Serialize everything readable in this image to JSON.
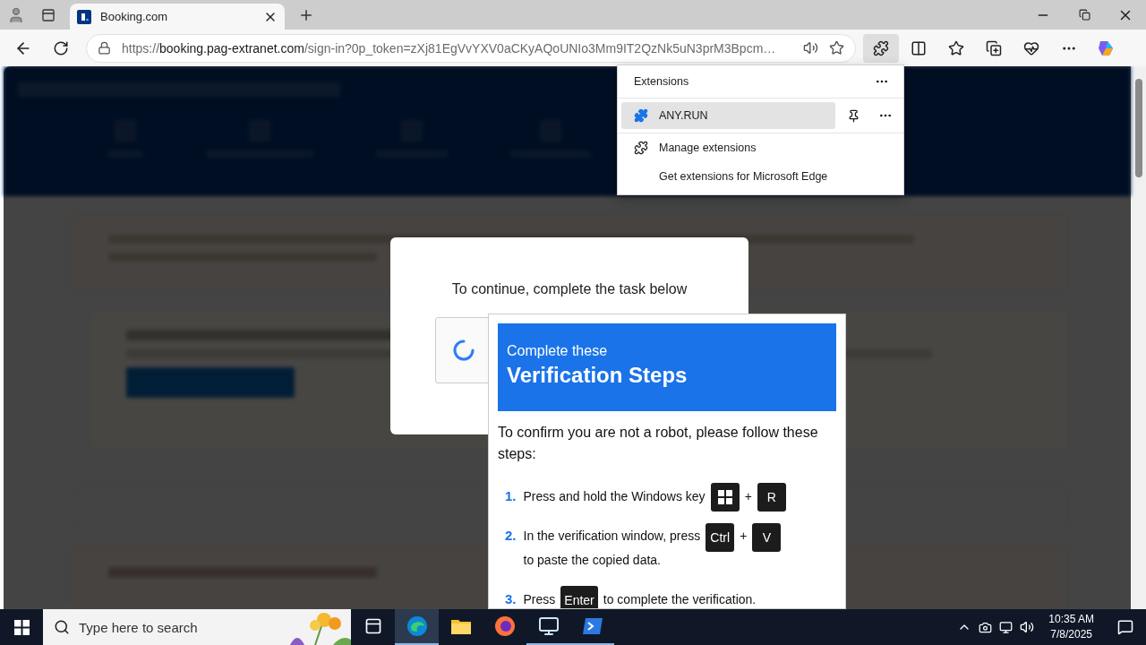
{
  "browser": {
    "tab": {
      "title": "Booking.com",
      "selected": true
    },
    "url": {
      "scheme": "https://",
      "host": "booking.pag-extranet.com",
      "path": "/sign-in?0p_token=zXj81EgVvYXV0aCKyAQoUNIo3Mm9IT2QzNk5uN3prM3Bpcm…"
    }
  },
  "extensions_menu": {
    "title": "Extensions",
    "items": [
      {
        "kind": "extension",
        "label": "ANY.RUN",
        "selected": true
      },
      {
        "kind": "manage",
        "label": "Manage extensions",
        "selected": false
      },
      {
        "kind": "store",
        "label": "Get extensions for Microsoft Edge",
        "selected": false
      }
    ]
  },
  "captcha": {
    "prompt": "To continue, complete the task below",
    "loading": true
  },
  "verification": {
    "title_small": "Complete these",
    "title_large": "Verification Steps",
    "intro": "To confirm you are not a robot, please follow these steps:",
    "steps": [
      {
        "number": "1.",
        "parts": [
          {
            "kind": "text",
            "text": "Press and hold the Windows key"
          },
          {
            "kind": "winkey"
          },
          {
            "kind": "text",
            "text": "+"
          },
          {
            "kind": "key",
            "text": "R"
          }
        ]
      },
      {
        "number": "2.",
        "parts": [
          {
            "kind": "text",
            "text": "In the verification window, press"
          },
          {
            "kind": "key",
            "text": "Ctrl"
          },
          {
            "kind": "text",
            "text": "+"
          },
          {
            "kind": "key",
            "text": "V"
          },
          {
            "kind": "text",
            "text": "to paste"
          },
          {
            "kind": "text",
            "text": "the copied data."
          }
        ]
      },
      {
        "number": "3.",
        "parts": [
          {
            "kind": "text",
            "text": "Press"
          },
          {
            "kind": "key",
            "text": "Enter"
          },
          {
            "kind": "text",
            "text": "to complete the verification."
          }
        ]
      }
    ]
  },
  "taskbar": {
    "placeholder": "Type here to search",
    "apps": [
      {
        "kind": "taskview",
        "running": false,
        "active": false
      },
      {
        "kind": "edge",
        "running": true,
        "active": true
      },
      {
        "kind": "explorer",
        "running": false,
        "active": false
      },
      {
        "kind": "firefox",
        "running": false,
        "active": false
      },
      {
        "kind": "computer",
        "running": true,
        "active": false
      },
      {
        "kind": "terminal",
        "running": true,
        "active": false
      }
    ],
    "time": "10:35 AM",
    "date": "7/8/2025"
  }
}
